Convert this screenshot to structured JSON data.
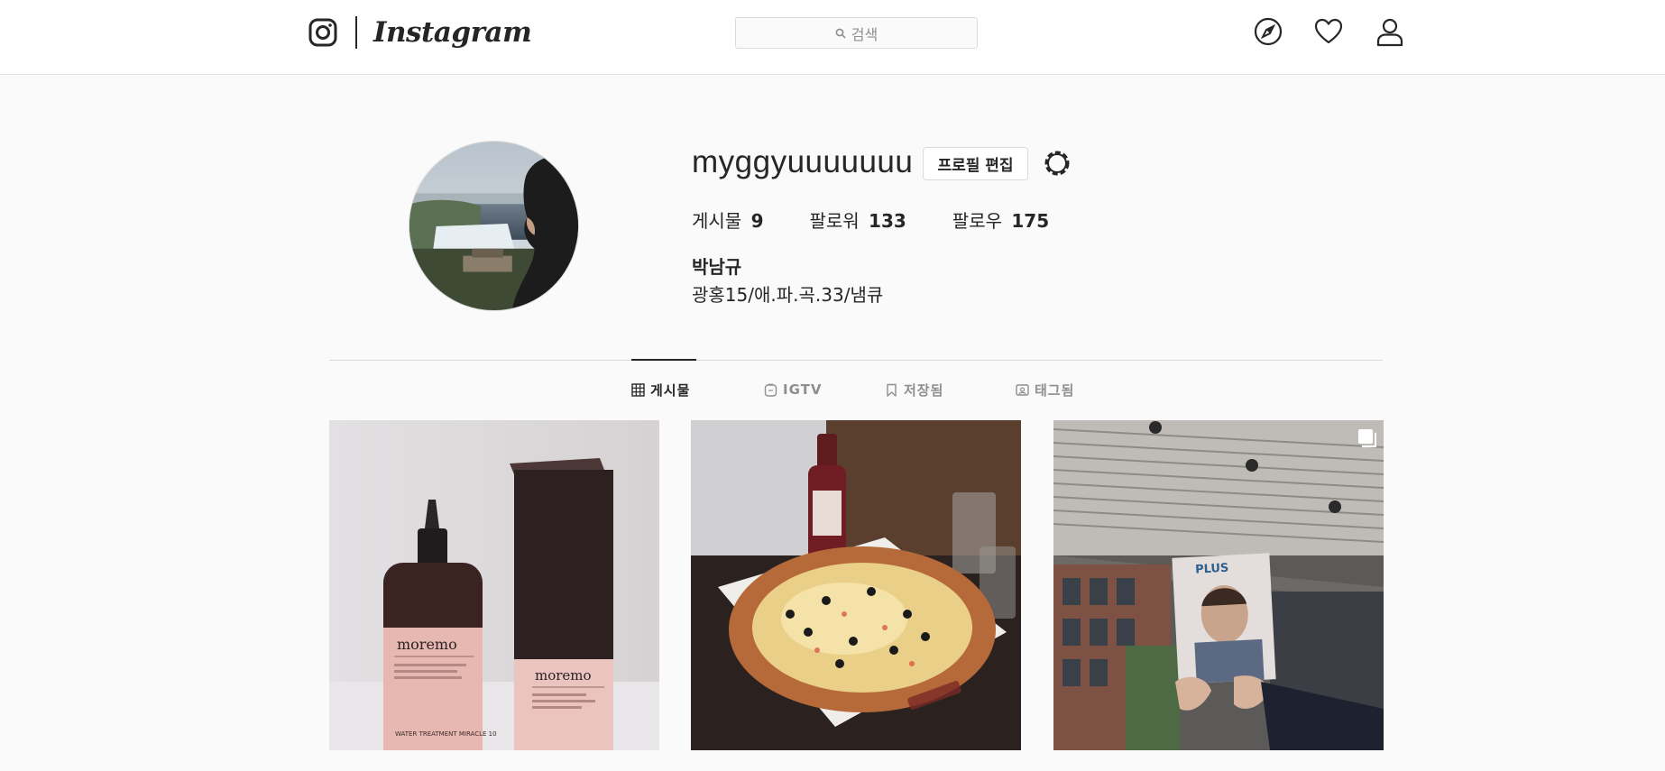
{
  "header": {
    "logo_text": "Instagram",
    "search_placeholder": "검색",
    "icons": [
      "instagram-camera-icon",
      "search-icon",
      "compass-icon",
      "heart-icon",
      "user-icon"
    ]
  },
  "profile": {
    "username": "myggyuuuuuuu",
    "edit_button": "프로필 편집",
    "stats": [
      {
        "label": "게시물",
        "value": "9"
      },
      {
        "label": "팔로워",
        "value": "133"
      },
      {
        "label": "팔로우",
        "value": "175"
      }
    ],
    "full_name": "박남규",
    "bio": "광홍15/애.파.곡.33/냄큐"
  },
  "tabs": [
    {
      "label": "게시물",
      "icon": "grid-icon",
      "active": true
    },
    {
      "label": "IGTV",
      "icon": "igtv-icon",
      "active": false
    },
    {
      "label": "저장됨",
      "icon": "bookmark-icon",
      "active": false
    },
    {
      "label": "태그됨",
      "icon": "tag-icon",
      "active": false
    }
  ],
  "posts": [
    {
      "bottle_label": "moremo",
      "bottle_caption": "WATER TREATMENT\nMIRACLE 10",
      "box_label": "moremo",
      "multi": false
    },
    {
      "bottle_label": "",
      "multi": false
    },
    {
      "magazine_title": "PLUS",
      "multi": true
    }
  ],
  "colors": {
    "text": "#262626",
    "muted": "#8e8e8e",
    "border": "#dbdbdb",
    "background": "#fafafa"
  }
}
